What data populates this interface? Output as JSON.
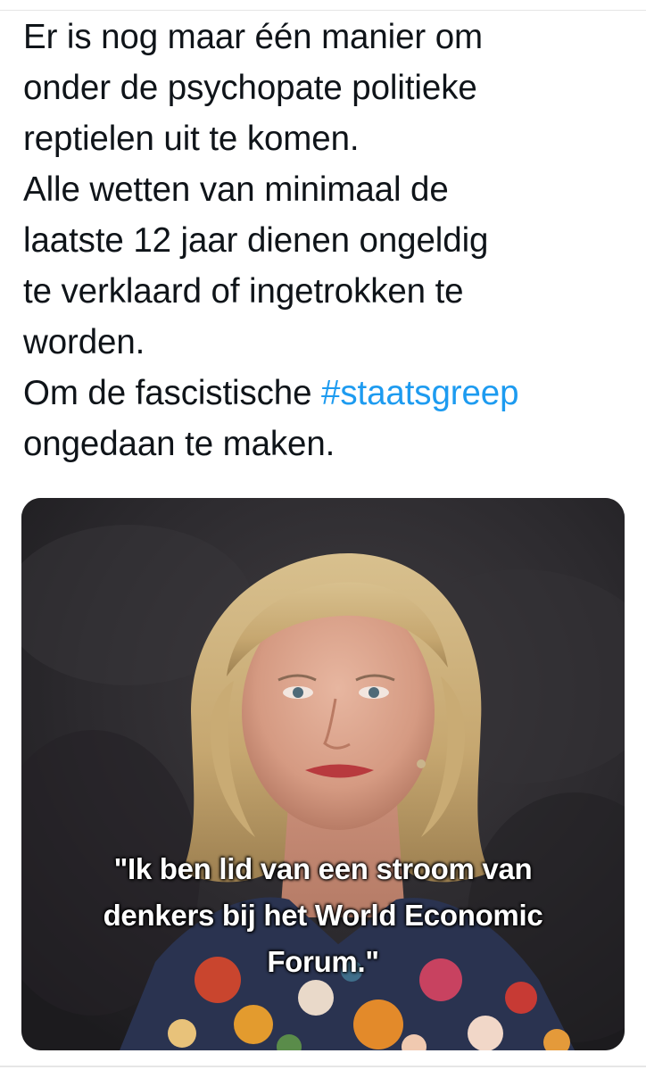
{
  "tweet": {
    "lines": [
      "Er is nog maar één manier om",
      "onder de psychopate politieke",
      "reptielen uit te komen.",
      "Alle wetten van minimaal de",
      "laatste 12 jaar dienen ongeldig",
      "te verklaard of ingetrokken te",
      "worden."
    ],
    "last_para_prefix": "Om de fascistische ",
    "hashtag": "#staatsgreep",
    "last_line": "ongedaan te maken."
  },
  "media": {
    "caption_lines": [
      "\"Ik ben lid van een stroom van",
      "denkers bij het World Economic",
      "Forum.\""
    ]
  },
  "colors": {
    "text": "#0f1419",
    "hashtag": "#1d9bf0",
    "background": "#ffffff"
  }
}
